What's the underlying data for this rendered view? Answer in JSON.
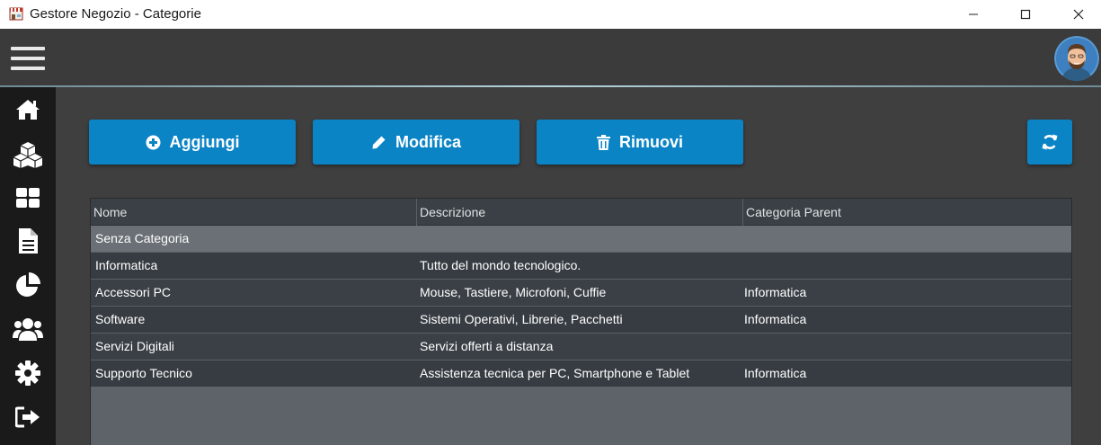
{
  "window": {
    "title": "Gestore Negozio - Categorie",
    "controls": [
      "minimize-icon",
      "maximize-icon",
      "close-icon"
    ]
  },
  "header": {
    "menu_icon": "hamburger-menu-icon",
    "avatar_icon": "user-avatar"
  },
  "sidebar": {
    "items": [
      {
        "icon": "home-icon"
      },
      {
        "icon": "cubes-icon"
      },
      {
        "icon": "grid-icon"
      },
      {
        "icon": "document-icon"
      },
      {
        "icon": "pie-chart-icon"
      },
      {
        "icon": "users-icon"
      },
      {
        "icon": "gear-icon"
      },
      {
        "icon": "sign-out-icon"
      }
    ]
  },
  "toolbar": {
    "add_label": "Aggiungi",
    "edit_label": "Modifica",
    "remove_label": "Rimuovi",
    "refresh_icon": "refresh-icon"
  },
  "table": {
    "columns": [
      "Nome",
      "Descrizione",
      "Categoria Parent"
    ],
    "rows": [
      {
        "nome": "Senza Categoria",
        "descrizione": "",
        "parent": ""
      },
      {
        "nome": "Informatica",
        "descrizione": "Tutto del mondo tecnologico.",
        "parent": ""
      },
      {
        "nome": "Accessori PC",
        "descrizione": "Mouse, Tastiere, Microfoni, Cuffie",
        "parent": "Informatica"
      },
      {
        "nome": "Software",
        "descrizione": "Sistemi Operativi, Librerie, Pacchetti",
        "parent": "Informatica"
      },
      {
        "nome": "Servizi Digitali",
        "descrizione": "Servizi offerti a distanza",
        "parent": ""
      },
      {
        "nome": "Supporto Tecnico",
        "descrizione": "Assistenza tecnica per PC, Smartphone e Tablet",
        "parent": "Informatica"
      }
    ],
    "selected_row": 0
  },
  "colors": {
    "accent": "#0b84c6",
    "sidebar": "#1a1a1a",
    "header": "#3b3b3b",
    "table_bg": "#5d6369"
  }
}
